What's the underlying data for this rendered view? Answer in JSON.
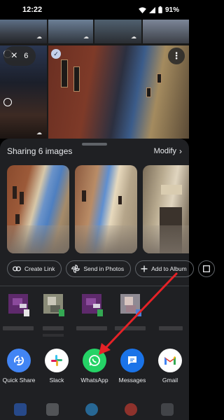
{
  "status_bar": {
    "time": "12:22",
    "battery": "91%",
    "icons": [
      "wifi-icon",
      "signal-icon",
      "battery-icon"
    ]
  },
  "gallery": {
    "selection_count": "6",
    "icons": [
      "close-icon",
      "more-vert-icon",
      "cloud-icon"
    ]
  },
  "share_sheet": {
    "title": "Sharing 6 images",
    "modify_label": "Modify",
    "action_chips": [
      {
        "label": "Create Link",
        "icon": "link-icon"
      },
      {
        "label": "Send in Photos",
        "icon": "photos-pinwheel-icon"
      },
      {
        "label": "Add to Album",
        "icon": "plus-icon"
      }
    ],
    "direct_share_contacts": 5,
    "apps": [
      {
        "label": "Quick Share",
        "icon": "quick-share-icon",
        "color": "#4285f4"
      },
      {
        "label": "Slack",
        "icon": "slack-icon",
        "color": "#ffffff"
      },
      {
        "label": "WhatsApp",
        "icon": "whatsapp-icon",
        "color": "#25d366"
      },
      {
        "label": "Messages",
        "icon": "messages-icon",
        "color": "#1a73e8"
      },
      {
        "label": "Gmail",
        "icon": "gmail-icon",
        "color": "#ffffff"
      }
    ]
  },
  "colors": {
    "sheet_bg": "#1f2023",
    "annotation_arrow": "#e52227",
    "selection_check": "#c4d1ea"
  }
}
